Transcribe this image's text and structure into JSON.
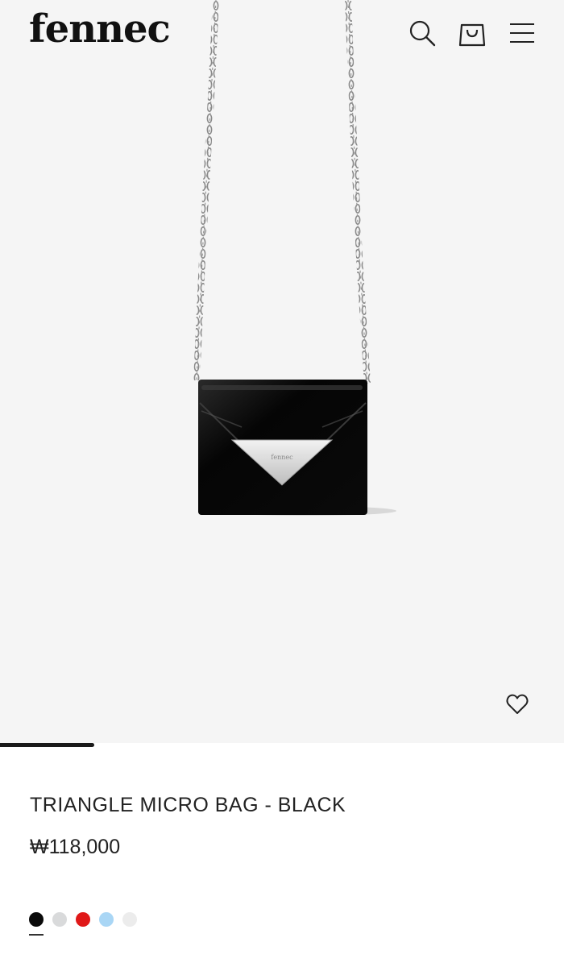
{
  "header": {
    "logo_text": "fennec",
    "icons": [
      "search-icon",
      "shopping-bag-icon",
      "menu-icon"
    ]
  },
  "hero": {
    "background": "#f5f5f5",
    "plate_text": "fennec",
    "wishlist_icon": "heart-icon",
    "slide_progress": 0.167
  },
  "product": {
    "title": "TRIANGLE MICRO BAG - BLACK",
    "price": "₩118,000"
  },
  "colors": {
    "options": [
      "#0a0a0a",
      "#d9dadb",
      "#e01818",
      "#a9d6f5",
      "#ececec"
    ],
    "selected_index": 0
  }
}
